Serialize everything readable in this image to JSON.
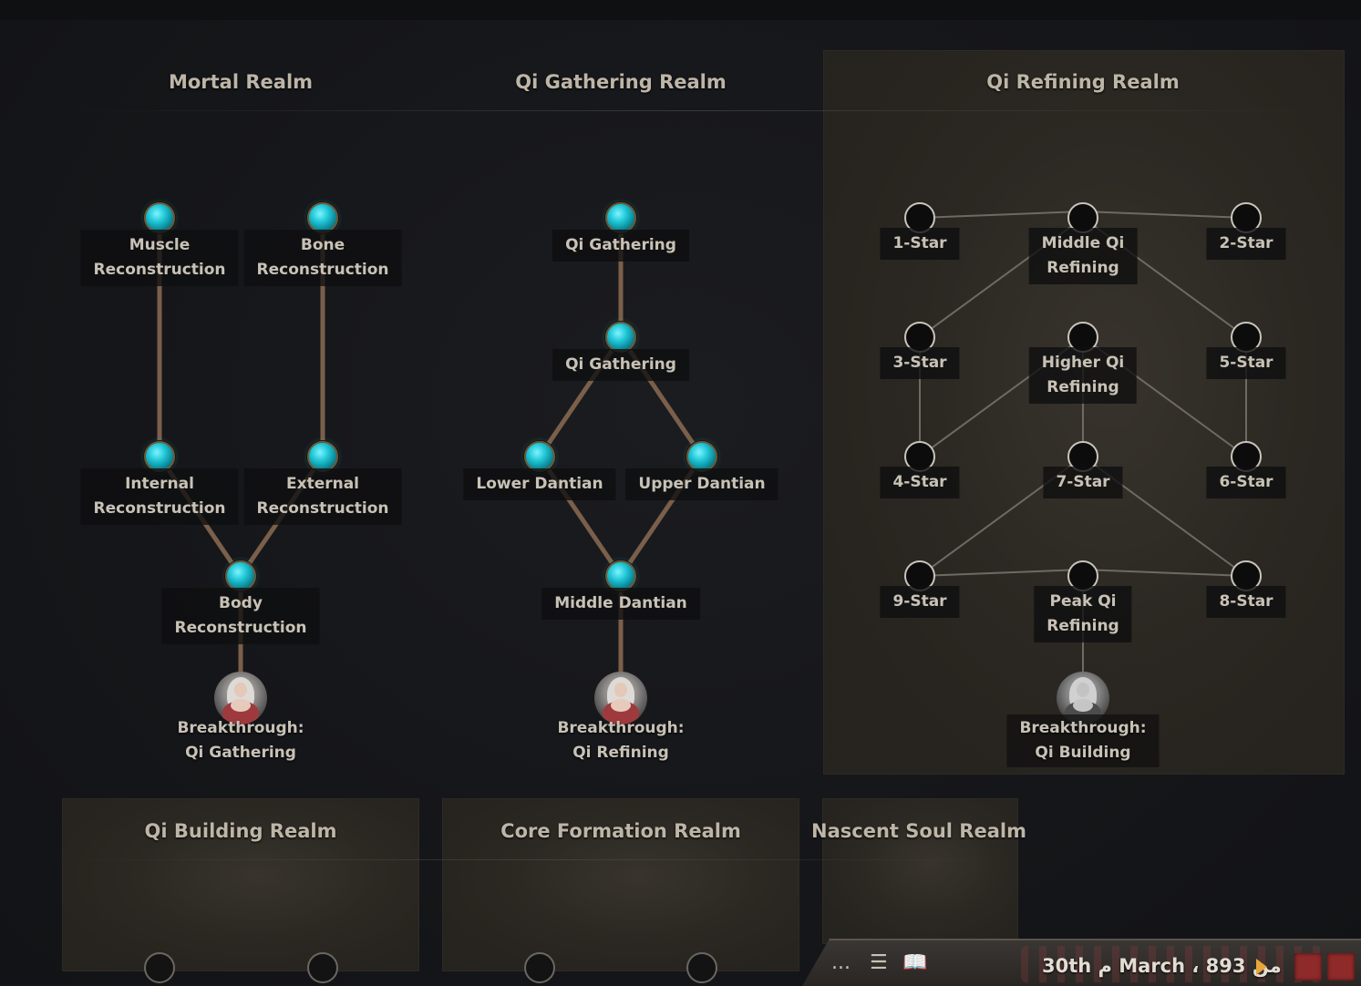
{
  "top_hint": "",
  "realms": {
    "mortal": {
      "title": "Mortal Realm",
      "nodes": {
        "muscle": "Muscle\nReconstruction",
        "bone": "Bone\nReconstruction",
        "internal": "Internal\nReconstruction",
        "external": "External\nReconstruction",
        "body": "Body\nReconstruction"
      },
      "breakthrough": "Breakthrough:\nQi Gathering"
    },
    "qi_gathering": {
      "title": "Qi Gathering Realm",
      "nodes": {
        "qi1": "Qi Gathering",
        "qi2": "Qi Gathering",
        "lower": "Lower Dantian",
        "upper": "Upper Dantian",
        "middle": "Middle Dantian"
      },
      "breakthrough": "Breakthrough:\nQi Refining"
    },
    "qi_refining": {
      "title": "Qi Refining Realm",
      "nodes": {
        "s1": "1-Star",
        "mid": "Middle Qi\nRefining",
        "s2": "2-Star",
        "s3": "3-Star",
        "higher": "Higher Qi\nRefining",
        "s5": "5-Star",
        "s4": "4-Star",
        "s7": "7-Star",
        "s6": "6-Star",
        "s9": "9-Star",
        "peak": "Peak Qi\nRefining",
        "s8": "8-Star"
      },
      "breakthrough": "Breakthrough:\nQi Building"
    },
    "qi_building": {
      "title": "Qi Building Realm"
    },
    "core_formation": {
      "title": "Core Formation Realm"
    },
    "nascent_soul": {
      "title": "Nascent Soul Realm"
    }
  },
  "statusbar": {
    "more_label": "...",
    "date": "30th م March ، 893 من",
    "speed_level": 2
  },
  "colors": {
    "learned_node": "#1fc6d6",
    "link": "#7a5f4a",
    "empty_node_border": "#c9c4ba",
    "speed_active": "#8e2a2a"
  }
}
